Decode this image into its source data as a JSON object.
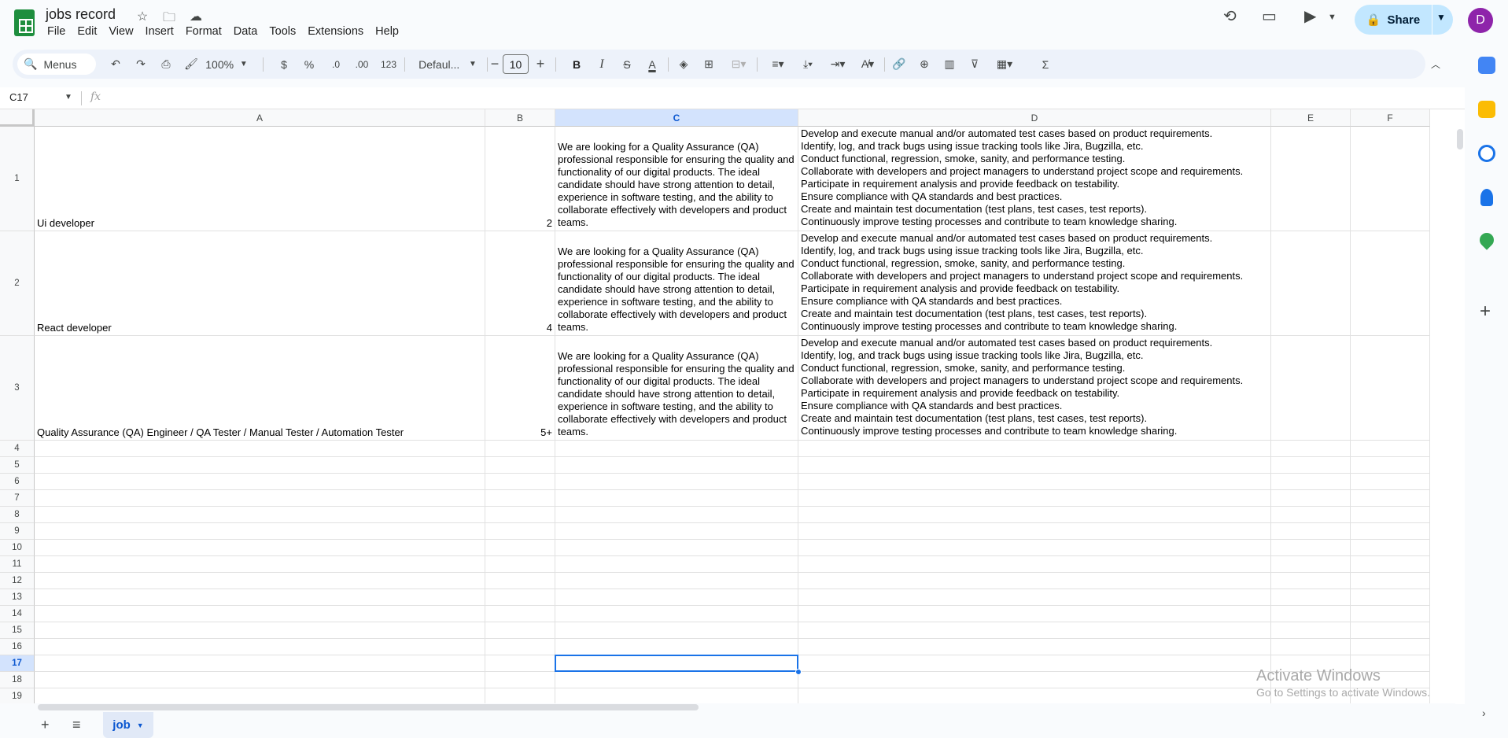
{
  "doc": {
    "title": "jobs record"
  },
  "menu": [
    "File",
    "Edit",
    "View",
    "Insert",
    "Format",
    "Data",
    "Tools",
    "Extensions",
    "Help"
  ],
  "share": {
    "label": "Share"
  },
  "user": {
    "initial": "D",
    "color": "#8e24aa"
  },
  "toolbar": {
    "search_label": "Menus",
    "zoom": "100%",
    "currency": "$",
    "percent": "%",
    "dec_less": ".0",
    "dec_more": ".00",
    "number_format": "123",
    "font": "Defaul...",
    "font_size": "10",
    "bold": "B",
    "italic": "I",
    "strike": "S",
    "text_color": "A"
  },
  "formula_bar": {
    "cell_ref": "C17",
    "fx": "fx",
    "value": ""
  },
  "columns": [
    "A",
    "B",
    "C",
    "D",
    "E",
    "F"
  ],
  "selected_column": "C",
  "selected_row": "17",
  "rows": [
    {
      "num": "1",
      "a": "Ui developer",
      "b": "2",
      "c": "We are looking for a Quality Assurance (QA) professional responsible for ensuring the quality and functionality of our digital products. The ideal candidate should have strong attention to detail, experience in software testing, and the ability to collaborate effectively with developers and product teams.",
      "d": [
        "Develop and execute manual and/or automated test cases based on product requirements.",
        "Identify, log, and track bugs using issue tracking tools like Jira, Bugzilla, etc.",
        "Conduct functional, regression, smoke, sanity, and performance testing.",
        "Collaborate with developers and project managers to understand project scope and requirements.",
        "Participate in requirement analysis and provide feedback on testability.",
        "Ensure compliance with QA standards and best practices.",
        "Create and maintain test documentation (test plans, test cases, test reports).",
        "Continuously improve testing processes and contribute to team knowledge sharing."
      ]
    },
    {
      "num": "2",
      "a": "React developer",
      "b": "4",
      "c": "We are looking for a Quality Assurance (QA) professional responsible for ensuring the quality and functionality of our digital products. The ideal candidate should have strong attention to detail, experience in software testing, and the ability to collaborate effectively with developers and product teams.",
      "d": [
        "Develop and execute manual and/or automated test cases based on product requirements.",
        "Identify, log, and track bugs using issue tracking tools like Jira, Bugzilla, etc.",
        "Conduct functional, regression, smoke, sanity, and performance testing.",
        "Collaborate with developers and project managers to understand project scope and requirements.",
        "Participate in requirement analysis and provide feedback on testability.",
        "Ensure compliance with QA standards and best practices.",
        "Create and maintain test documentation (test plans, test cases, test reports).",
        "Continuously improve testing processes and contribute to team knowledge sharing."
      ]
    },
    {
      "num": "3",
      "a": "Quality Assurance (QA) Engineer / QA Tester / Manual Tester / Automation Tester",
      "b": "5+",
      "c": "We are looking for a Quality Assurance (QA) professional responsible for ensuring the quality and functionality of our digital products. The ideal candidate should have strong attention to detail, experience in software testing, and the ability to collaborate effectively with developers and product teams.",
      "d": [
        "Develop and execute manual and/or automated test cases based on product requirements.",
        "Identify, log, and track bugs using issue tracking tools like Jira, Bugzilla, etc.",
        "Conduct functional, regression, smoke, sanity, and performance testing.",
        "Collaborate with developers and project managers to understand project scope and requirements.",
        "Participate in requirement analysis and provide feedback on testability.",
        "Ensure compliance with QA standards and best practices.",
        "Create and maintain test documentation (test plans, test cases, test reports).",
        "Continuously improve testing processes and contribute to team knowledge sharing."
      ]
    }
  ],
  "empty_rows": [
    "4",
    "5",
    "6",
    "7",
    "8",
    "9",
    "10",
    "11",
    "12",
    "13",
    "14",
    "15",
    "16",
    "17",
    "18",
    "19"
  ],
  "sheet_tab": {
    "name": "job"
  },
  "watermark": {
    "line1": "Activate Windows",
    "line2": "Go to Settings to activate Windows."
  },
  "sidebar_icons": [
    "calendar-icon",
    "keep-icon",
    "tasks-icon",
    "contacts-icon",
    "maps-icon"
  ]
}
